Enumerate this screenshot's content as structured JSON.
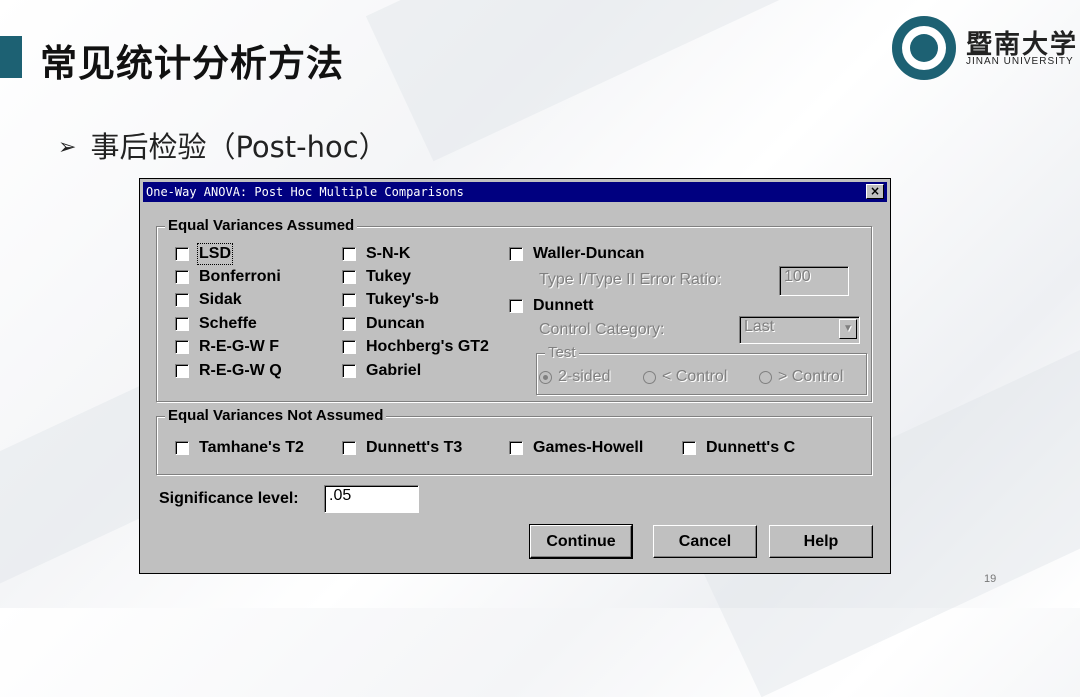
{
  "slide": {
    "title": "常见统计分析方法",
    "bullet": "事后检验（Post-hoc）",
    "page_number": "19",
    "university_cn": "暨南大学",
    "university_en": "JINAN UNIVERSITY",
    "accent_color": "#1d6173"
  },
  "dialog": {
    "title": "One-Way ANOVA: Post Hoc Multiple Comparisons",
    "close": "×",
    "equal_assumed": {
      "label": "Equal Variances Assumed",
      "col1": [
        "LSD",
        "Bonferroni",
        "Sidak",
        "Scheffe",
        "R-E-G-W F",
        "R-E-G-W Q"
      ],
      "col2": [
        "S-N-K",
        "Tukey",
        "Tukey's-b",
        "Duncan",
        "Hochberg's GT2",
        "Gabriel"
      ],
      "waller_duncan": "Waller-Duncan",
      "type_ratio_label": "Type I/Type II Error Ratio:",
      "type_ratio_value": "100",
      "dunnett": "Dunnett",
      "control_category_label": "Control Category:",
      "control_category_value": "Last",
      "test_label": "Test",
      "test_options": [
        "2-sided",
        "< Control",
        "> Control"
      ]
    },
    "not_assumed": {
      "label": "Equal Variances Not Assumed",
      "items": [
        "Tamhane's T2",
        "Dunnett's T3",
        "Games-Howell",
        "Dunnett's C"
      ]
    },
    "significance_label": "Significance level:",
    "significance_value": ".05",
    "buttons": {
      "continue": "Continue",
      "cancel": "Cancel",
      "help": "Help"
    }
  }
}
